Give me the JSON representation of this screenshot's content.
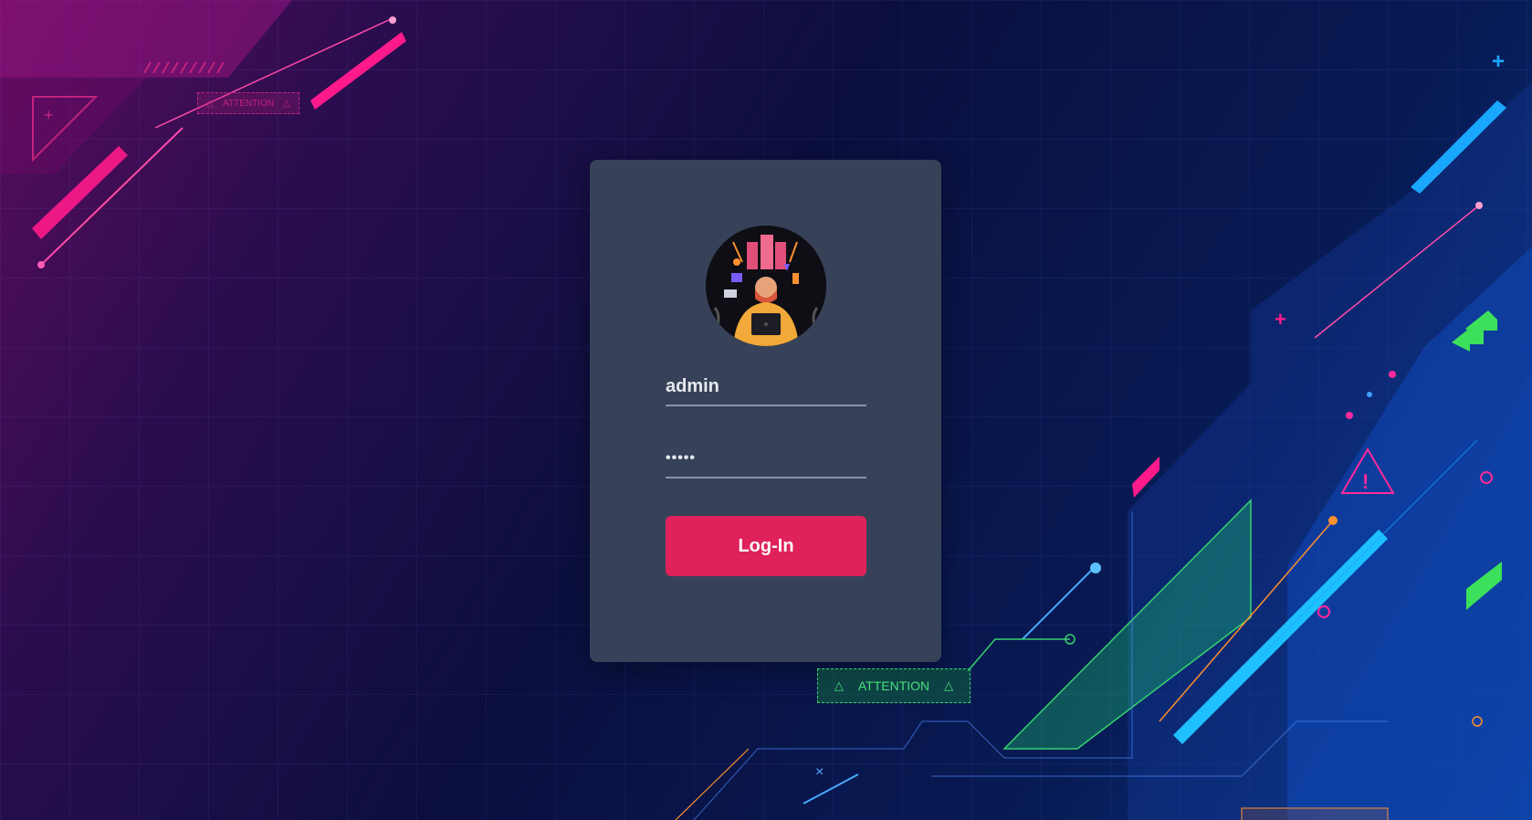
{
  "login": {
    "username_value": "admin",
    "password_value": "•••••",
    "button_label": "Log-In"
  },
  "decor": {
    "attention_label": "ATTENTION",
    "attention_small_label": "ATTENTION"
  },
  "colors": {
    "card": "#374259",
    "button": "#e0225a",
    "accent_pink": "#ff1a8c",
    "accent_blue": "#1aa7ff",
    "accent_green": "#35d36e"
  },
  "icons": {
    "avatar": "hacker-avatar-icon",
    "warning": "warning-triangle-icon",
    "plus": "plus-icon",
    "chevrons": "chevron-up-icon"
  }
}
